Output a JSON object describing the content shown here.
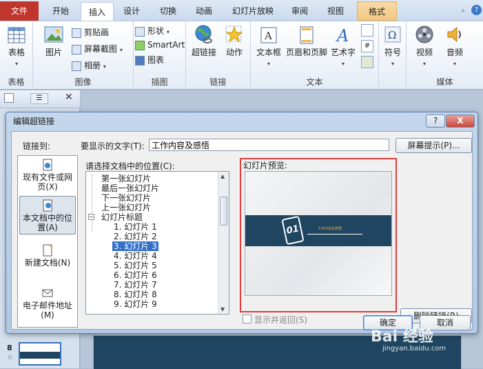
{
  "ribbon_tabs": [
    "文件",
    "开始",
    "插入",
    "设计",
    "切换",
    "动画",
    "幻灯片放映",
    "审阅",
    "视图",
    "格式"
  ],
  "ribbon_active_tab": "插入",
  "ribbon": {
    "table_group": {
      "button": "表格",
      "label": "表格"
    },
    "image_group": {
      "picture": "图片",
      "clipart": "剪贴画",
      "screenshot": "屏幕截图",
      "album": "相册",
      "label": "图像"
    },
    "illustration_group": {
      "shapes": "形状",
      "smartart": "SmartArt",
      "chart": "图表",
      "label": "插图"
    },
    "link_group": {
      "hyperlink": "超链接",
      "action": "动作",
      "label": "链接"
    },
    "text_group": {
      "textbox": "文本框",
      "header_footer": "页眉和页脚",
      "wordart": "艺术字",
      "label": "文本"
    },
    "symbol_group": {
      "symbol": "符号"
    },
    "media_group": {
      "video": "视频",
      "audio": "音频",
      "label": "媒体"
    }
  },
  "left_panel": {
    "slide_number": "8"
  },
  "dialog": {
    "title": "编辑超链接",
    "help": "?",
    "close": "X",
    "link_to_label": "链接到:",
    "display_text_label": "要显示的文字(T):",
    "display_text_value": "工作内容及感悟",
    "screentip_button": "屏幕提示(P)...",
    "select_place_label": "请选择文档中的位置(C):",
    "preview_label": "幻灯片预览:",
    "link_to_items": [
      {
        "label": "现有文件或网页(X)"
      },
      {
        "label": "本文档中的位置(A)"
      },
      {
        "label": "新建文档(N)"
      },
      {
        "label": "电子邮件地址(M)"
      }
    ],
    "tree_items": [
      "第一张幻灯片",
      "最后一张幻灯片",
      "下一张幻灯片",
      "上一张幻灯片",
      "幻灯片标题",
      "1. 幻灯片 1",
      "2. 幻灯片 2",
      "3. 幻灯片 3",
      "4. 幻灯片 4",
      "5. 幻灯片 5",
      "6. 幻灯片 6",
      "7. 幻灯片 7",
      "8. 幻灯片 8",
      "9. 幻灯片 9"
    ],
    "tree_selected": "3. 幻灯片 3",
    "show_return_label": "显示并返回(S)",
    "remove_link_button": "删除链接(R)",
    "ok_button": "确定",
    "cancel_button": "取消",
    "preview": {
      "number": "01",
      "title": "工作内容及感悟"
    }
  },
  "watermark": {
    "text": "Bai 经验",
    "url": "jingyan.baidu.com"
  }
}
